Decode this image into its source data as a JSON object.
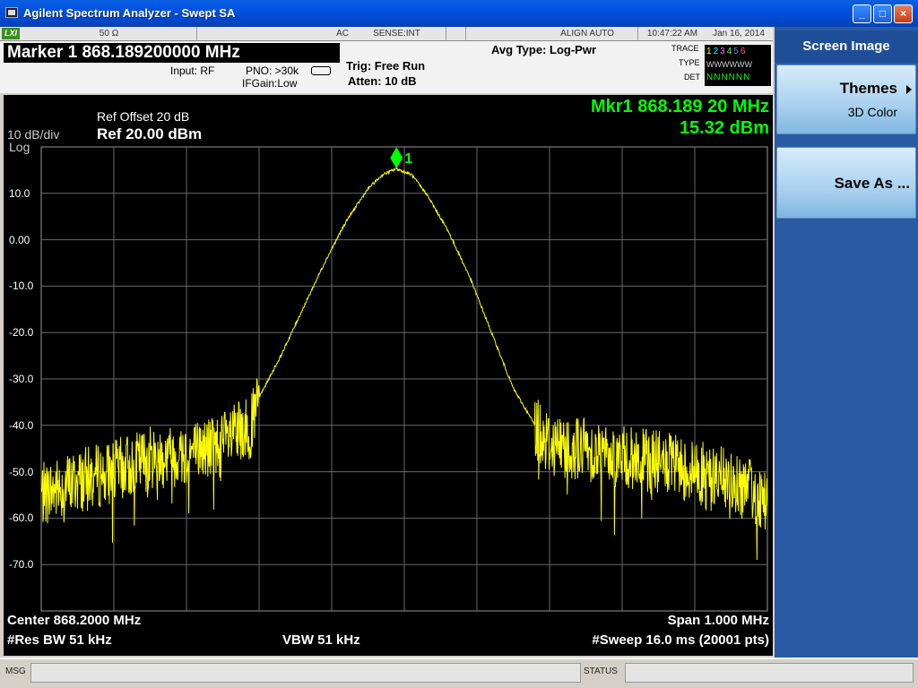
{
  "window": {
    "title": "Agilent Spectrum Analyzer - Swept SA",
    "minimize": "_",
    "maximize": "□",
    "close": "×"
  },
  "status_strip": {
    "lxi": "LXI",
    "impedance": "50 Ω",
    "coupling": "AC",
    "sense": "SENSE:INT",
    "align": "ALIGN AUTO",
    "time": "10:47:22 AM",
    "date": "Jan 16, 2014"
  },
  "header": {
    "marker": "Marker 1  868.189200000 MHz",
    "input": "Input: RF",
    "pno": "PNO: >30k",
    "ifgain": "IFGain:Low",
    "trig": "Trig: Free Run",
    "atten": "Atten: 10 dB",
    "avg_type": "Avg Type: Log-Pwr",
    "trace_label": "TRACE",
    "type_label": "TYPE",
    "det_label": "DET",
    "trace_nums": [
      "1",
      "2",
      "3",
      "4",
      "5",
      "6"
    ],
    "type_vals": "WWWWWW",
    "det_vals": "NNNNNN",
    "trace_colors": [
      "#ffff00",
      "#00ffff",
      "#ff66ff",
      "#66ff66",
      "#6688ff",
      "#ff6666"
    ]
  },
  "plot": {
    "ref_offset": "Ref Offset 20 dB",
    "scale": "10 dB/div",
    "scale_type": "Log",
    "ref_level": "Ref 20.00 dBm",
    "marker_readout_freq": "Mkr1 868.189 20 MHz",
    "marker_readout_amp": "15.32 dBm",
    "marker_label": "1",
    "y_labels": [
      "10.0",
      "0.00",
      "-10.0",
      "-20.0",
      "-30.0",
      "-40.0",
      "-50.0",
      "-60.0",
      "-70.0"
    ],
    "center": "Center 868.2000 MHz",
    "res_bw": "#Res BW 51 kHz",
    "vbw": "VBW 51 kHz",
    "span": "Span 1.000 MHz",
    "sweep": "#Sweep  16.0 ms (20001 pts)",
    "trace_color": "#ffff00",
    "marker_color": "#00ff00"
  },
  "chart_data": {
    "type": "line",
    "xlabel": "",
    "ylabel": "",
    "x_center_mhz": 868.2,
    "x_span_mhz": 1.0,
    "ylim": [
      -80,
      20
    ],
    "grid": true,
    "series": [
      {
        "x": [
          867.7,
          867.75,
          867.8,
          867.85,
          867.9,
          867.95,
          867.99,
          868.0,
          868.03,
          868.06,
          868.09,
          868.12,
          868.15,
          868.17,
          868.189,
          868.21,
          868.23,
          868.26,
          868.29,
          868.32,
          868.35,
          868.38,
          868.4,
          868.45,
          868.5,
          868.55,
          868.6,
          868.65,
          868.7
        ],
        "y": [
          -55,
          -52,
          -50,
          -47,
          -46,
          -44,
          -40,
          -34,
          -25,
          -15,
          -5,
          4,
          11,
          14,
          15.32,
          14,
          10,
          2,
          -8,
          -20,
          -32,
          -40,
          -44,
          -45,
          -47,
          -48,
          -50,
          -52,
          -56
        ]
      }
    ],
    "marker": {
      "x": 868.1892,
      "y": 15.32
    }
  },
  "softkeys": {
    "title": "Screen Image",
    "themes_label": "Themes",
    "themes_sub": "3D Color",
    "save_label": "Save As ..."
  },
  "bottom": {
    "msg": "MSG",
    "status": "STATUS"
  }
}
